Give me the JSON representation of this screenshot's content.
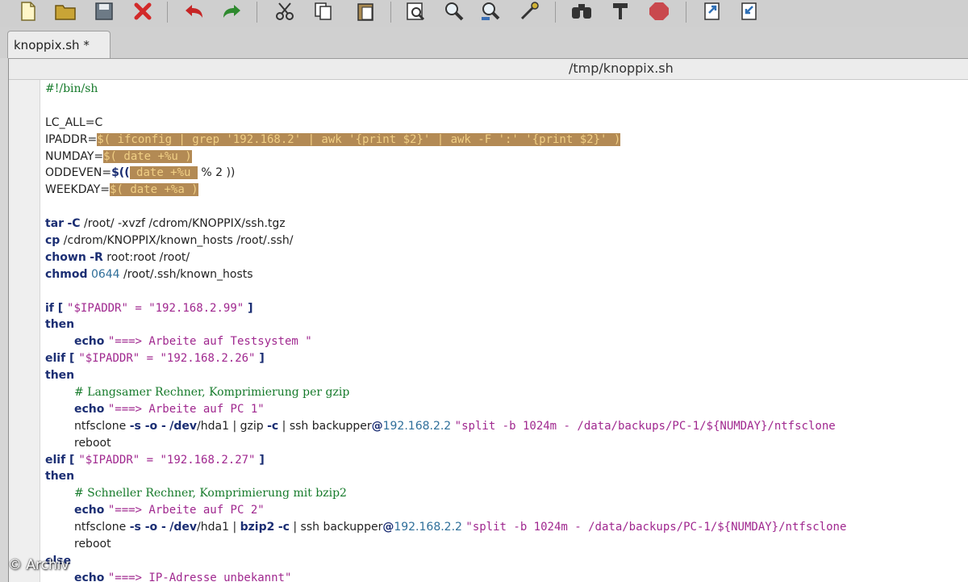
{
  "window": {
    "tab": {
      "label": "knoppix.sh *"
    },
    "path": "/tmp/knoppix.sh"
  },
  "toolbar": {
    "icons": [
      "new-file-icon",
      "open-folder-icon",
      "save-icon",
      "close-icon",
      "undo-icon",
      "redo-icon",
      "cut-icon",
      "copy-icon",
      "paste-icon",
      "find-file-icon",
      "search-icon",
      "find-replace-icon",
      "replace-icon",
      "binoculars-icon",
      "tools-icon",
      "stop-icon",
      "export-icon",
      "import-icon"
    ]
  },
  "code": {
    "lines": {
      "l1": "#!/bin/sh",
      "l3": "LC_ALL=C",
      "l4a": "IPADDR=",
      "l4b": "$( ifconfig | grep '192.168.2' | awk '{print $2}' | awk -F ':' '{print $2}' )",
      "l5a": "NUMDAY=",
      "l5b": "$( date +%u )",
      "l6a": "ODDEVEN=",
      "l6b": "$((",
      "l6c": " date +%u ",
      "l6d": " % 2 ))",
      "l7a": "WEEKDAY=",
      "l7b": "$( date +%a )",
      "l9a": "tar",
      "l9b": "-C",
      "l9c": " /root/ -xvzf /cdrom/KNOPPIX/ssh.tgz",
      "l10a": "cp",
      "l10b": " /cdrom/KNOPPIX/known_hosts /root/.ssh/",
      "l11a": "chown",
      "l11b": "-R",
      "l11c": " root:root /root/",
      "l12a": "chmod",
      "l12b": "0644",
      "l12c": " /root/.ssh/known_hosts",
      "l14a": "if",
      "l14b": " [ ",
      "l14c": "\"$IPADDR\" = \"192.168.2.99\"",
      "l14d": " ]",
      "l15": "then",
      "l16a": "echo",
      "l16b": "\"===> Arbeite auf Testsystem \"",
      "l17a": "elif",
      "l17b": " [ ",
      "l17c": "\"$IPADDR\" = \"192.168.2.26\"",
      "l17d": " ]",
      "l18": "then",
      "l19": "# Langsamer Rechner, Komprimierung per gzip",
      "l20a": "echo",
      "l20b": "\"===> Arbeite auf PC 1\"",
      "l21a": "ntfsclone",
      "l21b": "-s -o -",
      "l21c": "/dev",
      "l21d": "/hda1 | ",
      "l21e": "gzip",
      "l21f": "-c",
      "l21g": " | ssh backupper",
      "l21h": "@",
      "l21i": "192.168.2.2",
      "l21j": "\"split -b 1024m - /data/backups/PC-1/${NUMDAY}/ntfsclone",
      "l22": "reboot",
      "l23a": "elif",
      "l23b": " [ ",
      "l23c": "\"$IPADDR\" = \"192.168.2.27\"",
      "l23d": " ]",
      "l24": "then",
      "l25": "# Schneller Rechner, Komprimierung mit bzip2",
      "l26a": "echo",
      "l26b": "\"===> Arbeite auf PC 2\"",
      "l27a": "ntfsclone",
      "l27b": "-s -o -",
      "l27c": "/dev",
      "l27d": "/hda1 | ",
      "l27e": "bzip2",
      "l27f": "-c",
      "l27g": " | ssh backupper",
      "l27h": "@",
      "l27i": "192.168.2.2",
      "l27j": "\"split -b 1024m - /data/backups/PC-1/${NUMDAY}/ntfsclone",
      "l28": "reboot",
      "l29a": "else",
      "l30a": "echo",
      "l30b": "\"===> IP-Adresse unbekannt\""
    }
  },
  "watermark": "© Archiv"
}
